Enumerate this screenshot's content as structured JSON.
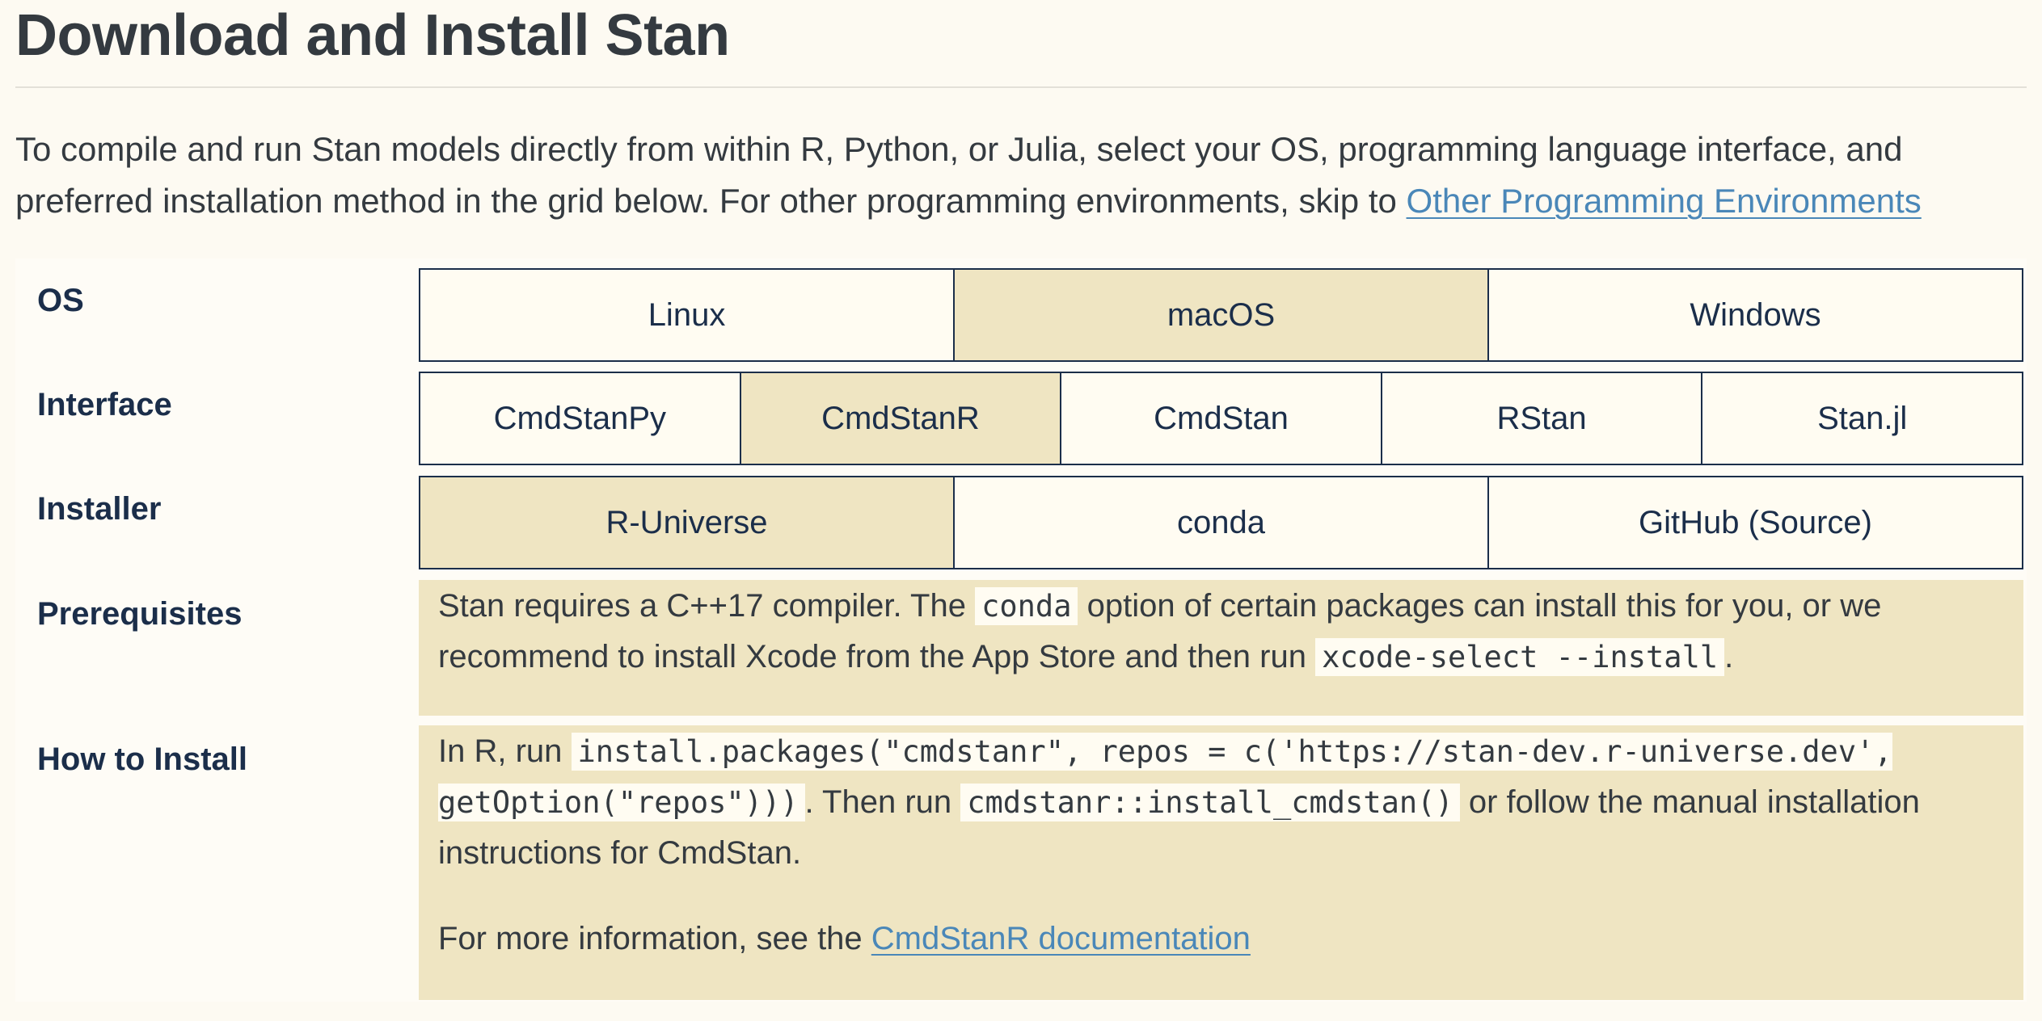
{
  "page": {
    "title": "Download and Install Stan",
    "intro_text": "To compile and run Stan models directly from within R, Python, or Julia, select your OS, programming language interface, and preferred installation method in the grid below. For other programming environments, skip to ",
    "intro_link": "Other Programming Environments"
  },
  "grid": {
    "os": {
      "label": "OS",
      "options": [
        "Linux",
        "macOS",
        "Windows"
      ],
      "selected": "macOS"
    },
    "interface": {
      "label": "Interface",
      "options": [
        "CmdStanPy",
        "CmdStanR",
        "CmdStan",
        "RStan",
        "Stan.jl"
      ],
      "selected": "CmdStanR"
    },
    "installer": {
      "label": "Installer",
      "options": [
        "R-Universe",
        "conda",
        "GitHub (Source)"
      ],
      "selected": "R-Universe"
    },
    "prerequisites": {
      "label": "Prerequisites",
      "text_1": "Stan requires a C++17 compiler. The ",
      "code_1": "conda",
      "text_2": " option of certain packages can install this for you, or we recommend to install Xcode from the App Store and then run ",
      "code_2": "xcode-select --install",
      "text_3": "."
    },
    "how_to_install": {
      "label": "How to Install",
      "text_1": "In R, run ",
      "code_1": "install.packages(\"cmdstanr\", repos = c('https://stan-dev.r-universe.dev', getOption(\"repos\")))",
      "text_2": ". Then run ",
      "code_2": "cmdstanr::install_cmdstan()",
      "text_3": " or follow the manual installation instructions for CmdStan.",
      "more_text": "For more information, see the ",
      "more_link": "CmdStanR documentation"
    }
  },
  "colors": {
    "background": "#fdfaf2",
    "selected": "#efe5c2",
    "border": "#1b2e4a",
    "link": "#4a87b8"
  }
}
